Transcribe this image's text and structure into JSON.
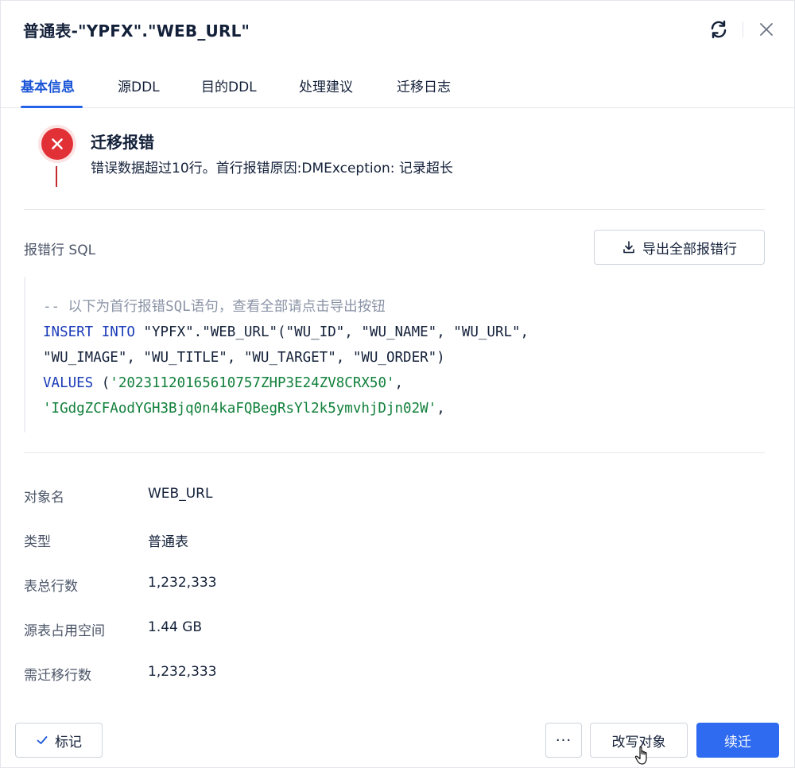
{
  "dialog": {
    "title": "普通表-\"YPFX\".\"WEB_URL\""
  },
  "tabs": [
    {
      "label": "基本信息",
      "active": true
    },
    {
      "label": "源DDL",
      "active": false
    },
    {
      "label": "目的DDL",
      "active": false
    },
    {
      "label": "处理建议",
      "active": false
    },
    {
      "label": "迁移日志",
      "active": false
    }
  ],
  "status": {
    "icon": "error-icon",
    "title": "迁移报错",
    "description": "错误数据超过10行。首行报错原因:DMException: 记录超长"
  },
  "sql": {
    "label": "报错行 SQL",
    "export_label": "导出全部报错行",
    "comment": "-- 以下为首行报错SQL语句，查看全部请点击导出按钮",
    "kw_insert": "INSERT INTO",
    "insert_rest": " \"YPFX\".\"WEB_URL\"(\"WU_ID\", \"WU_NAME\", \"WU_URL\",",
    "line3": "\"WU_IMAGE\", \"WU_TITLE\", \"WU_TARGET\", \"WU_ORDER\")",
    "kw_values": "VALUES",
    "values_open": " (",
    "value1": "'20231120165610757ZHP3E24ZV8CRX50'",
    "value1_sep": ",",
    "value2": "'IGdgZCFAodYGH3Bjq0n4kaFQBegRsYl2k5ymvhjDjn02W'",
    "value2_sep": ","
  },
  "info": [
    {
      "key": "对象名",
      "value": "WEB_URL"
    },
    {
      "key": "类型",
      "value": "普通表"
    },
    {
      "key": "表总行数",
      "value": "1,232,333"
    },
    {
      "key": "源表占用空间",
      "value": "1.44 GB"
    },
    {
      "key": "需迁移行数",
      "value": "1,232,333"
    }
  ],
  "footer": {
    "mark_label": "标记",
    "more_label": "···",
    "rewrite_label": "改写对象",
    "continue_label": "续迁"
  },
  "colors": {
    "accent": "#2e6bf0",
    "error": "#e13137",
    "string": "#11803b",
    "keyword": "#1a3cb8"
  }
}
